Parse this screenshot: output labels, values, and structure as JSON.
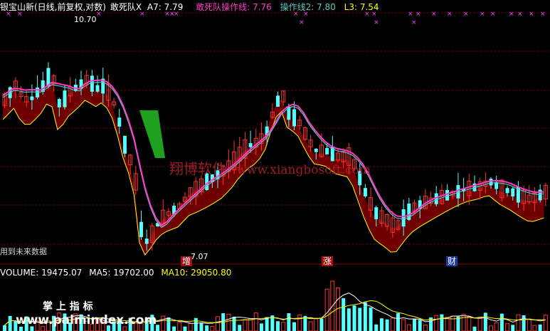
{
  "header": {
    "title": "银宝山新(日线,前复权,对数)",
    "indicator": "敢死队X",
    "a7_label": "A7:",
    "a7_value": "7.79",
    "line1_label": "敢死队操作线:",
    "line1_value": "7.76",
    "line2_label": "操作线2:",
    "line2_value": "7.80",
    "l3_label": "L3:",
    "l3_value": "7.54"
  },
  "annotations": {
    "high_price": "10.70",
    "low_price": "7.07",
    "future_data_note": "用到未来数据",
    "marker_zeng": "增",
    "marker_zhang": "涨",
    "marker_cai": "财"
  },
  "volume": {
    "label": "VOLUME:",
    "value": "19475.07",
    "ma5_label": "MA5:",
    "ma5_value": "19702.00",
    "ma10_label": "MA10:",
    "ma10_value": "29050.80"
  },
  "watermarks": {
    "site_cn": "翔博软件",
    "site_url": "www.xiangbosoft.com",
    "palm_cn": "掌 上 指 标",
    "palm_url": "www.palmindex.com"
  },
  "colors": {
    "background": "#000000",
    "up_candle": "#ff3232",
    "down_candle": "#54ffff",
    "header_white": "#ffffff",
    "magenta_line": "#ff3cc8",
    "cyan_line": "#62c2c2",
    "yellow": "#ffff00",
    "band_fill": "#7a0000",
    "green_fill": "#1fa01f",
    "grid": "#8b0000",
    "marker_x": "#ff44ff"
  }
}
